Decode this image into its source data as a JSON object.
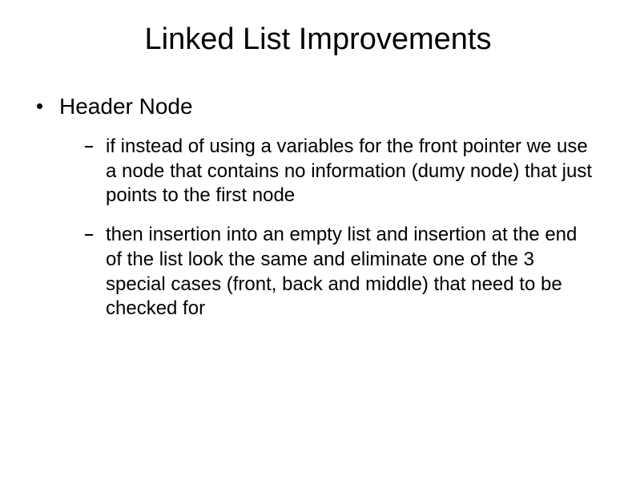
{
  "title": "Linked List Improvements",
  "bullets": {
    "level1": [
      {
        "text": "Header Node",
        "children": [
          "if instead of using a variables for the front pointer we use a node that contains no information  (dumy node) that just points to the first node",
          "then insertion into an empty list and insertion at the end of the list look the same and eliminate one of the 3 special cases  (front, back and middle) that need to be checked for"
        ]
      }
    ]
  }
}
